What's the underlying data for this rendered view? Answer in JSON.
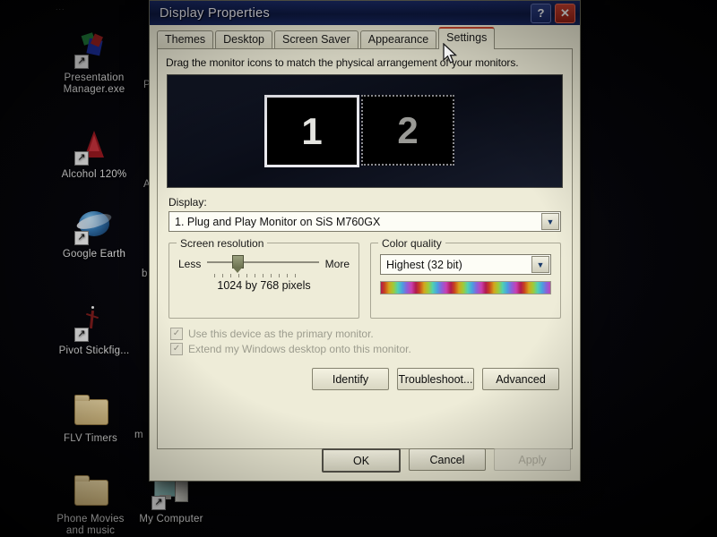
{
  "desktop": {
    "icons": [
      {
        "name": "Presentation Manager.exe",
        "type": "app-shortcut"
      },
      {
        "name": "Alcohol 120%",
        "type": "app-shortcut"
      },
      {
        "name": "Google Earth",
        "type": "app-shortcut"
      },
      {
        "name": "Pivot Stickfig...",
        "type": "app-shortcut"
      },
      {
        "name": "FLV Timers",
        "type": "folder"
      },
      {
        "name": "Phone Movies and music",
        "type": "folder"
      },
      {
        "name": "My Computer",
        "type": "system"
      }
    ],
    "occluded_labels": [
      "P",
      "A",
      "b",
      "m"
    ],
    "top_faint_text": "..."
  },
  "dialog": {
    "title": "Display Properties",
    "title_buttons": {
      "help": "?",
      "close": "✕"
    },
    "tabs": [
      {
        "label": "Themes",
        "active": false
      },
      {
        "label": "Desktop",
        "active": false
      },
      {
        "label": "Screen Saver",
        "active": false
      },
      {
        "label": "Appearance",
        "active": false
      },
      {
        "label": "Settings",
        "active": true
      }
    ],
    "settings": {
      "hint": "Drag the monitor icons to match the physical arrangement of your monitors.",
      "monitors": [
        {
          "number": "1",
          "selected": true
        },
        {
          "number": "2",
          "selected": false
        }
      ],
      "display_label": "Display:",
      "display_value": "1. Plug and Play Monitor on SiS M760GX",
      "screen_resolution": {
        "group_title": "Screen resolution",
        "less_label": "Less",
        "more_label": "More",
        "value_text": "1024 by 768 pixels",
        "slider_percent": 22
      },
      "color_quality": {
        "group_title": "Color quality",
        "value": "Highest (32 bit)"
      },
      "checkboxes": [
        {
          "label": "Use this device as the primary monitor.",
          "checked": true,
          "enabled": false
        },
        {
          "label": "Extend my Windows desktop onto this monitor.",
          "checked": true,
          "enabled": false
        }
      ],
      "action_buttons": [
        {
          "label": "Identify",
          "enabled": true
        },
        {
          "label": "Troubleshoot...",
          "enabled": true
        },
        {
          "label": "Advanced",
          "enabled": true
        }
      ]
    },
    "footer_buttons": [
      {
        "label": "OK",
        "enabled": true,
        "default": true
      },
      {
        "label": "Cancel",
        "enabled": true,
        "default": false
      },
      {
        "label": "Apply",
        "enabled": false,
        "default": false
      }
    ]
  },
  "colors": {
    "titlebar": "#0d1840",
    "dialog_bg": "#eeecd8",
    "active_tab_accent": "#c8442c",
    "close_button": "#c9402e",
    "desktop_bg": "#000000"
  }
}
